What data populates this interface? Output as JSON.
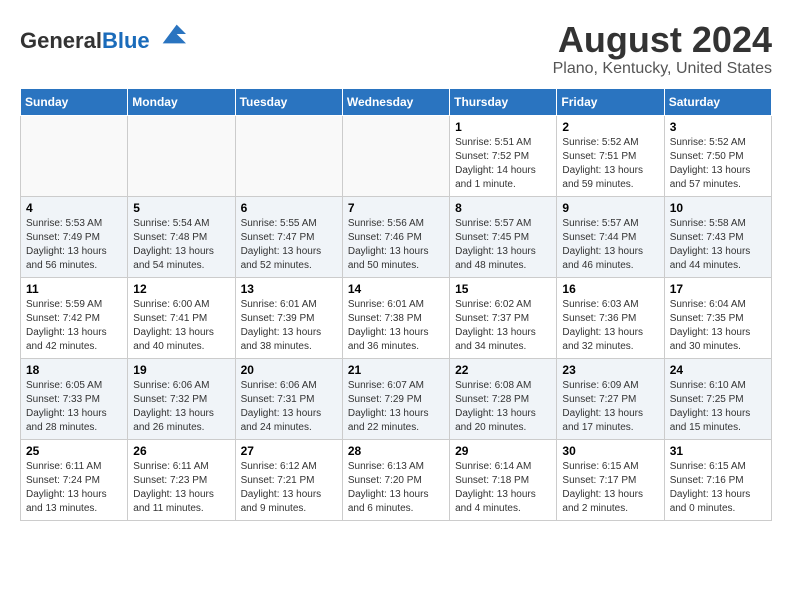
{
  "header": {
    "logo_general": "General",
    "logo_blue": "Blue",
    "month_year": "August 2024",
    "location": "Plano, Kentucky, United States"
  },
  "days_of_week": [
    "Sunday",
    "Monday",
    "Tuesday",
    "Wednesday",
    "Thursday",
    "Friday",
    "Saturday"
  ],
  "weeks": [
    [
      {
        "day": "",
        "info": ""
      },
      {
        "day": "",
        "info": ""
      },
      {
        "day": "",
        "info": ""
      },
      {
        "day": "",
        "info": ""
      },
      {
        "day": "1",
        "info": "Sunrise: 5:51 AM\nSunset: 7:52 PM\nDaylight: 14 hours\nand 1 minute."
      },
      {
        "day": "2",
        "info": "Sunrise: 5:52 AM\nSunset: 7:51 PM\nDaylight: 13 hours\nand 59 minutes."
      },
      {
        "day": "3",
        "info": "Sunrise: 5:52 AM\nSunset: 7:50 PM\nDaylight: 13 hours\nand 57 minutes."
      }
    ],
    [
      {
        "day": "4",
        "info": "Sunrise: 5:53 AM\nSunset: 7:49 PM\nDaylight: 13 hours\nand 56 minutes."
      },
      {
        "day": "5",
        "info": "Sunrise: 5:54 AM\nSunset: 7:48 PM\nDaylight: 13 hours\nand 54 minutes."
      },
      {
        "day": "6",
        "info": "Sunrise: 5:55 AM\nSunset: 7:47 PM\nDaylight: 13 hours\nand 52 minutes."
      },
      {
        "day": "7",
        "info": "Sunrise: 5:56 AM\nSunset: 7:46 PM\nDaylight: 13 hours\nand 50 minutes."
      },
      {
        "day": "8",
        "info": "Sunrise: 5:57 AM\nSunset: 7:45 PM\nDaylight: 13 hours\nand 48 minutes."
      },
      {
        "day": "9",
        "info": "Sunrise: 5:57 AM\nSunset: 7:44 PM\nDaylight: 13 hours\nand 46 minutes."
      },
      {
        "day": "10",
        "info": "Sunrise: 5:58 AM\nSunset: 7:43 PM\nDaylight: 13 hours\nand 44 minutes."
      }
    ],
    [
      {
        "day": "11",
        "info": "Sunrise: 5:59 AM\nSunset: 7:42 PM\nDaylight: 13 hours\nand 42 minutes."
      },
      {
        "day": "12",
        "info": "Sunrise: 6:00 AM\nSunset: 7:41 PM\nDaylight: 13 hours\nand 40 minutes."
      },
      {
        "day": "13",
        "info": "Sunrise: 6:01 AM\nSunset: 7:39 PM\nDaylight: 13 hours\nand 38 minutes."
      },
      {
        "day": "14",
        "info": "Sunrise: 6:01 AM\nSunset: 7:38 PM\nDaylight: 13 hours\nand 36 minutes."
      },
      {
        "day": "15",
        "info": "Sunrise: 6:02 AM\nSunset: 7:37 PM\nDaylight: 13 hours\nand 34 minutes."
      },
      {
        "day": "16",
        "info": "Sunrise: 6:03 AM\nSunset: 7:36 PM\nDaylight: 13 hours\nand 32 minutes."
      },
      {
        "day": "17",
        "info": "Sunrise: 6:04 AM\nSunset: 7:35 PM\nDaylight: 13 hours\nand 30 minutes."
      }
    ],
    [
      {
        "day": "18",
        "info": "Sunrise: 6:05 AM\nSunset: 7:33 PM\nDaylight: 13 hours\nand 28 minutes."
      },
      {
        "day": "19",
        "info": "Sunrise: 6:06 AM\nSunset: 7:32 PM\nDaylight: 13 hours\nand 26 minutes."
      },
      {
        "day": "20",
        "info": "Sunrise: 6:06 AM\nSunset: 7:31 PM\nDaylight: 13 hours\nand 24 minutes."
      },
      {
        "day": "21",
        "info": "Sunrise: 6:07 AM\nSunset: 7:29 PM\nDaylight: 13 hours\nand 22 minutes."
      },
      {
        "day": "22",
        "info": "Sunrise: 6:08 AM\nSunset: 7:28 PM\nDaylight: 13 hours\nand 20 minutes."
      },
      {
        "day": "23",
        "info": "Sunrise: 6:09 AM\nSunset: 7:27 PM\nDaylight: 13 hours\nand 17 minutes."
      },
      {
        "day": "24",
        "info": "Sunrise: 6:10 AM\nSunset: 7:25 PM\nDaylight: 13 hours\nand 15 minutes."
      }
    ],
    [
      {
        "day": "25",
        "info": "Sunrise: 6:11 AM\nSunset: 7:24 PM\nDaylight: 13 hours\nand 13 minutes."
      },
      {
        "day": "26",
        "info": "Sunrise: 6:11 AM\nSunset: 7:23 PM\nDaylight: 13 hours\nand 11 minutes."
      },
      {
        "day": "27",
        "info": "Sunrise: 6:12 AM\nSunset: 7:21 PM\nDaylight: 13 hours\nand 9 minutes."
      },
      {
        "day": "28",
        "info": "Sunrise: 6:13 AM\nSunset: 7:20 PM\nDaylight: 13 hours\nand 6 minutes."
      },
      {
        "day": "29",
        "info": "Sunrise: 6:14 AM\nSunset: 7:18 PM\nDaylight: 13 hours\nand 4 minutes."
      },
      {
        "day": "30",
        "info": "Sunrise: 6:15 AM\nSunset: 7:17 PM\nDaylight: 13 hours\nand 2 minutes."
      },
      {
        "day": "31",
        "info": "Sunrise: 6:15 AM\nSunset: 7:16 PM\nDaylight: 13 hours\nand 0 minutes."
      }
    ]
  ]
}
